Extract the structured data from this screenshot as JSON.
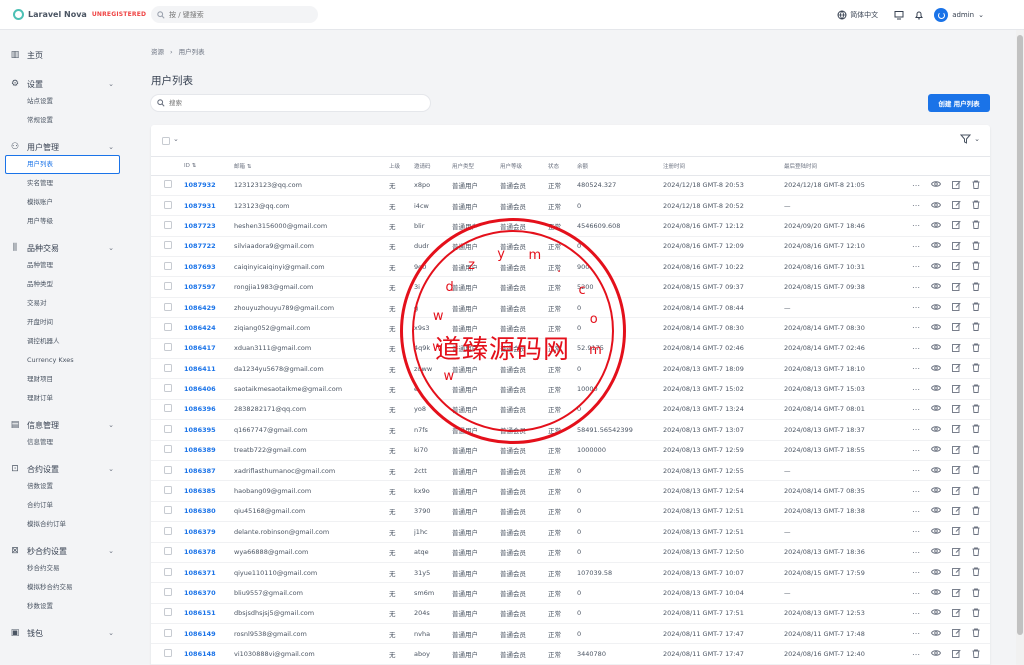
{
  "brand": {
    "name": "Laravel Nova",
    "badge": "UNREGISTERED"
  },
  "topbar": {
    "search_placeholder": "按 / 键搜索",
    "language": "简体中文",
    "user": "admin"
  },
  "sidebar": {
    "groups": [
      {
        "label": "主页",
        "icon": "dashboard-icon",
        "items": []
      },
      {
        "label": "设置",
        "icon": "gear-icon",
        "items": [
          "站点设置",
          "常规设置"
        ]
      },
      {
        "label": "用户管理",
        "icon": "users-icon",
        "items": [
          "用户列表",
          "实名管理",
          "模拟账户",
          "用户等级"
        ]
      },
      {
        "label": "品种交易",
        "icon": "sliders-icon",
        "items": [
          "品种管理",
          "品种类型",
          "交易对",
          "开盘时间",
          "调控机器人",
          "Currency Kxes",
          "理财项目",
          "理财订单"
        ]
      },
      {
        "label": "信息管理",
        "icon": "message-icon",
        "items": [
          "信息管理"
        ]
      },
      {
        "label": "合约设置",
        "icon": "presentation-icon",
        "items": [
          "倍数设置",
          "合约订单",
          "模拟合约订单"
        ]
      },
      {
        "label": "秒合约设置",
        "icon": "chart-icon",
        "items": [
          "秒合约交易",
          "模拟秒合约交易",
          "秒数设置"
        ]
      },
      {
        "label": "钱包",
        "icon": "wallet-icon",
        "items": []
      }
    ],
    "active_item": "用户列表"
  },
  "breadcrumb": {
    "root": "资源",
    "current": "用户列表"
  },
  "page": {
    "title": "用户列表",
    "search_placeholder": "搜索",
    "create_button": "创建 用户列表"
  },
  "table": {
    "columns": [
      "ID",
      "邮箱",
      "上级",
      "邀请码",
      "用户类型",
      "用户等级",
      "状态",
      "余额",
      "注册时间",
      "最后登陆时间"
    ],
    "rows": [
      [
        "1087932",
        "123123123@qq.com",
        "无",
        "x8po",
        "普通用户",
        "普通会员",
        "正常",
        "480524.327",
        "2024/12/18 GMT-8 20:53",
        "2024/12/18 GMT-8 21:05"
      ],
      [
        "1087931",
        "123123@qq.com",
        "无",
        "i4cw",
        "普通用户",
        "普通会员",
        "正常",
        "0",
        "2024/12/18 GMT-8 20:52",
        "—"
      ],
      [
        "1087723",
        "heshen3156000@gmail.com",
        "无",
        "blir",
        "普通用户",
        "普通会员",
        "正常",
        "4546609.608",
        "2024/08/16 GMT-7 12:12",
        "2024/09/20 GMT-7 18:46"
      ],
      [
        "1087722",
        "silviaadora9@gmail.com",
        "无",
        "dudr",
        "普通用户",
        "普通会员",
        "正常",
        "0",
        "2024/08/16 GMT-7 12:09",
        "2024/08/16 GMT-7 12:10"
      ],
      [
        "1087693",
        "caiqinyicaiqinyi@gmail.com",
        "无",
        "9g0",
        "普通用户",
        "普通会员",
        "正常",
        "900",
        "2024/08/16 GMT-7 10:22",
        "2024/08/16 GMT-7 10:31"
      ],
      [
        "1087597",
        "rongjia1983@gmail.com",
        "无",
        "3i",
        "普通用户",
        "普通会员",
        "正常",
        "5200",
        "2024/08/15 GMT-7 09:37",
        "2024/08/15 GMT-7 09:38"
      ],
      [
        "1086429",
        "zhouyuzhouyu789@gmail.com",
        "无",
        "g",
        "普通用户",
        "普通会员",
        "正常",
        "0",
        "2024/08/14 GMT-7 08:44",
        "—"
      ],
      [
        "1086424",
        "ziqiang052@gmail.com",
        "无",
        "x9s3",
        "普通用户",
        "普通会员",
        "正常",
        "0",
        "2024/08/14 GMT-7 08:30",
        "2024/08/14 GMT-7 08:30"
      ],
      [
        "1086417",
        "xduan3111@gmail.com",
        "无",
        "4q9k",
        "普通用户",
        "普通会员",
        "正常",
        "52.9175",
        "2024/08/14 GMT-7 02:46",
        "2024/08/14 GMT-7 02:46"
      ],
      [
        "1086411",
        "da1234yu5678@gmail.com",
        "无",
        "zuww",
        "普通用户",
        "普通会员",
        "正常",
        "0",
        "2024/08/13 GMT-7 18:09",
        "2024/08/13 GMT-7 18:10"
      ],
      [
        "1086406",
        "saotaikmesaotaikme@gmail.com",
        "无",
        "e",
        "普通用户",
        "普通会员",
        "正常",
        "10000",
        "2024/08/13 GMT-7 15:02",
        "2024/08/13 GMT-7 15:03"
      ],
      [
        "1086396",
        "2838282171@qq.com",
        "无",
        "yo8",
        "普通用户",
        "普通会员",
        "正常",
        "0",
        "2024/08/13 GMT-7 13:24",
        "2024/08/14 GMT-7 08:01"
      ],
      [
        "1086395",
        "q1667747@gmail.com",
        "无",
        "n7fs",
        "普通用户",
        "普通会员",
        "正常",
        "58491.56542399",
        "2024/08/13 GMT-7 13:07",
        "2024/08/13 GMT-7 18:37"
      ],
      [
        "1086389",
        "treatb722@gmail.com",
        "无",
        "ki70",
        "普通用户",
        "普通会员",
        "正常",
        "1000000",
        "2024/08/13 GMT-7 12:59",
        "2024/08/13 GMT-7 18:55"
      ],
      [
        "1086387",
        "xadriflasthumanoc@gmail.com",
        "无",
        "2ctt",
        "普通用户",
        "普通会员",
        "正常",
        "0",
        "2024/08/13 GMT-7 12:55",
        "—"
      ],
      [
        "1086385",
        "haobang09@gmail.com",
        "无",
        "kx9o",
        "普通用户",
        "普通会员",
        "正常",
        "0",
        "2024/08/13 GMT-7 12:54",
        "2024/08/14 GMT-7 08:35"
      ],
      [
        "1086380",
        "qiu45168@gmail.com",
        "无",
        "3790",
        "普通用户",
        "普通会员",
        "正常",
        "0",
        "2024/08/13 GMT-7 12:51",
        "2024/08/13 GMT-7 18:38"
      ],
      [
        "1086379",
        "delante.robinson@gmail.com",
        "无",
        "j1hc",
        "普通用户",
        "普通会员",
        "正常",
        "0",
        "2024/08/13 GMT-7 12:51",
        "—"
      ],
      [
        "1086378",
        "wya66888@gmail.com",
        "无",
        "atqe",
        "普通用户",
        "普通会员",
        "正常",
        "0",
        "2024/08/13 GMT-7 12:50",
        "2024/08/13 GMT-7 18:36"
      ],
      [
        "1086371",
        "qiyue110110@gmail.com",
        "无",
        "31y5",
        "普通用户",
        "普通会员",
        "正常",
        "107039.58",
        "2024/08/13 GMT-7 10:07",
        "2024/08/15 GMT-7 17:59"
      ],
      [
        "1086370",
        "bliu9557@gmail.com",
        "无",
        "sm6m",
        "普通用户",
        "普通会员",
        "正常",
        "0",
        "2024/08/13 GMT-7 10:04",
        "—"
      ],
      [
        "1086151",
        "dbsjsdhsjsj5@gmail.com",
        "无",
        "204s",
        "普通用户",
        "普通会员",
        "正常",
        "0",
        "2024/08/11 GMT-7 17:51",
        "2024/08/13 GMT-7 12:53"
      ],
      [
        "1086149",
        "rosnl9538@gmail.com",
        "无",
        "nvha",
        "普通用户",
        "普通会员",
        "正常",
        "0",
        "2024/08/11 GMT-7 17:47",
        "2024/08/11 GMT-7 17:48"
      ],
      [
        "1086148",
        "vi1030888vi@gmail.com",
        "无",
        "aboy",
        "普通用户",
        "普通会员",
        "正常",
        "3440780",
        "2024/08/11 GMT-7 17:47",
        "2024/08/16 GMT-7 12:40"
      ]
    ]
  },
  "watermark": {
    "text": "道臻源码网",
    "ring": "wwwdzym.com",
    "color": "#e4101b"
  }
}
